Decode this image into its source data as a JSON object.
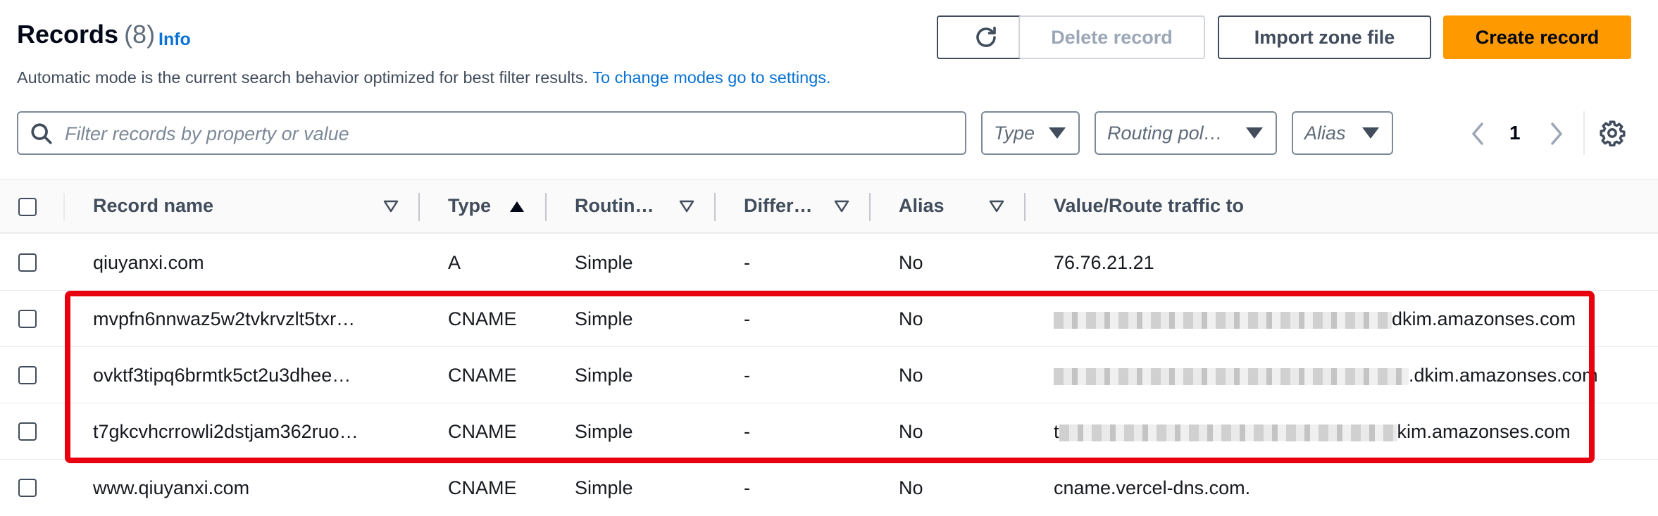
{
  "header": {
    "title": "Records",
    "count": "(8)",
    "info_link": "Info",
    "description": "Automatic mode is the current search behavior optimized for best filter results.",
    "settings_link": "To change modes go to settings."
  },
  "toolbar": {
    "refresh_icon": "refresh-icon",
    "delete_label": "Delete record",
    "import_label": "Import zone file",
    "create_label": "Create record"
  },
  "filters": {
    "search_placeholder": "Filter records by property or value",
    "type_label": "Type",
    "routing_label": "Routing pol…",
    "alias_label": "Alias"
  },
  "pagination": {
    "current_page": "1"
  },
  "table": {
    "columns": [
      "Record name",
      "Type",
      "Routin…",
      "Differ…",
      "Alias",
      "Value/Route traffic to"
    ],
    "rows": [
      {
        "name": "qiuyanxi.com",
        "type": "A",
        "routing": "Simple",
        "differ": "-",
        "alias": "No",
        "value_prefix": "",
        "value": "76.76.21.21"
      },
      {
        "name": "mvpfn6nnwaz5w2tvkrvzlt5txr…",
        "type": "CNAME",
        "routing": "Simple",
        "differ": "-",
        "alias": "No",
        "value_prefix": "",
        "value": "dkim.amazonses.com"
      },
      {
        "name": "ovktf3tipq6brmtk5ct2u3dhee…",
        "type": "CNAME",
        "routing": "Simple",
        "differ": "-",
        "alias": "No",
        "value_prefix": "",
        "value": ".dkim.amazonses.com"
      },
      {
        "name": "t7gkcvhcrrowli2dstjam362ruo…",
        "type": "CNAME",
        "routing": "Simple",
        "differ": "-",
        "alias": "No",
        "value_prefix": "t",
        "value": "kim.amazonses.com"
      },
      {
        "name": "www.qiuyanxi.com",
        "type": "CNAME",
        "routing": "Simple",
        "differ": "-",
        "alias": "No",
        "value_prefix": "",
        "value": "cname.vercel-dns.com."
      }
    ]
  },
  "colors": {
    "accent": "#0972d3",
    "primary_button": "#ff9900",
    "highlight_border": "#e8000f"
  }
}
